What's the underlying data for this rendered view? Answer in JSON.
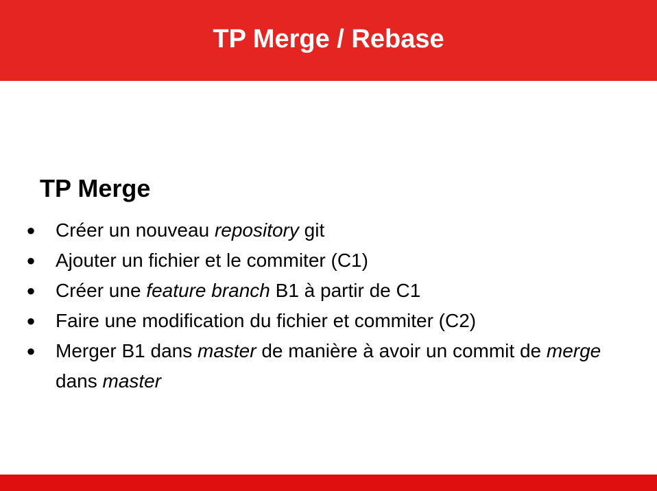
{
  "slide": {
    "title": "TP Merge / Rebase",
    "heading": "TP Merge",
    "bullet_symbol": "●",
    "bullets": [
      {
        "segments": [
          {
            "text": "Créer un nouveau ",
            "italic": false
          },
          {
            "text": "repository",
            "italic": true
          },
          {
            "text": " git",
            "italic": false
          }
        ]
      },
      {
        "segments": [
          {
            "text": "Ajouter un fichier et le commiter (C1)",
            "italic": false
          }
        ]
      },
      {
        "segments": [
          {
            "text": "Créer une ",
            "italic": false
          },
          {
            "text": "feature branch",
            "italic": true
          },
          {
            "text": " B1 à partir de C1",
            "italic": false
          }
        ]
      },
      {
        "segments": [
          {
            "text": "Faire une modification du fichier et commiter (C2)",
            "italic": false
          }
        ]
      },
      {
        "segments": [
          {
            "text": "Merger B1 dans ",
            "italic": false
          },
          {
            "text": "master",
            "italic": true
          },
          {
            "text": " de manière à avoir un commit de ",
            "italic": false
          },
          {
            "text": "merge",
            "italic": true
          },
          {
            "text": " dans ",
            "italic": false
          },
          {
            "text": "master",
            "italic": true
          }
        ]
      }
    ]
  },
  "colors": {
    "header_band": "#e52521",
    "footer_band": "#e00f0f",
    "title_text": "#ffffff",
    "body_text": "#000000"
  }
}
